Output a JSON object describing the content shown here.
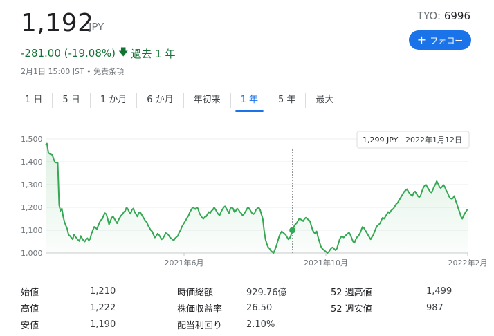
{
  "quote": {
    "price": "1,192",
    "currency": "JPY",
    "exchange": "TYO:",
    "symbol": "6996",
    "follow_label": "フォロー",
    "change": "-281.00 (-19.08%)",
    "period": "過去 1 年",
    "date_note": "2月1日 15:00 JST • 免責条項"
  },
  "colors": {
    "positive": "#137333",
    "accent": "#1a73e8",
    "line": "#34a853"
  },
  "tabs": [
    {
      "label": "1 日",
      "active": false
    },
    {
      "label": "5 日",
      "active": false
    },
    {
      "label": "1 か月",
      "active": false
    },
    {
      "label": "6 か月",
      "active": false
    },
    {
      "label": "年初来",
      "active": false
    },
    {
      "label": "1 年",
      "active": true
    },
    {
      "label": "5 年",
      "active": false
    },
    {
      "label": "最大",
      "active": false
    }
  ],
  "tooltip": {
    "value": "1,299 JPY",
    "date": "2022年1月12日"
  },
  "stats": [
    [
      {
        "label": "始値",
        "value": "1,210"
      },
      {
        "label": "時価総額",
        "value": "929.76億"
      },
      {
        "label": "52 週高値",
        "value": "1,499"
      }
    ],
    [
      {
        "label": "高値",
        "value": "1,222"
      },
      {
        "label": "株価収益率",
        "value": "26.50"
      },
      {
        "label": "52 週安値",
        "value": "987"
      }
    ],
    [
      {
        "label": "安値",
        "value": "1,190"
      },
      {
        "label": "配当利回り",
        "value": "2.10%"
      },
      {
        "label": "",
        "value": ""
      }
    ]
  ],
  "chart_data": {
    "type": "line",
    "ylim": [
      1000,
      1500
    ],
    "yticks": [
      "1,500",
      "1,400",
      "1,300",
      "1,200",
      "1,100",
      "1,000"
    ],
    "xticks": [
      "2021年6月",
      "2021年10月",
      "2022年2月"
    ],
    "grid": true,
    "highlight_index": 183,
    "values": [
      1473,
      1480,
      1440,
      1435,
      1432,
      1430,
      1410,
      1397,
      1396,
      1395,
      1210,
      1185,
      1195,
      1160,
      1135,
      1120,
      1105,
      1080,
      1075,
      1068,
      1060,
      1080,
      1072,
      1065,
      1058,
      1052,
      1075,
      1065,
      1055,
      1050,
      1060,
      1065,
      1055,
      1062,
      1085,
      1100,
      1115,
      1110,
      1105,
      1120,
      1135,
      1145,
      1150,
      1165,
      1175,
      1170,
      1150,
      1125,
      1140,
      1155,
      1160,
      1150,
      1140,
      1130,
      1145,
      1155,
      1165,
      1170,
      1180,
      1185,
      1200,
      1192,
      1180,
      1172,
      1190,
      1195,
      1180,
      1170,
      1160,
      1175,
      1180,
      1170,
      1160,
      1150,
      1140,
      1135,
      1120,
      1110,
      1100,
      1095,
      1080,
      1068,
      1075,
      1085,
      1080,
      1070,
      1060,
      1065,
      1075,
      1088,
      1085,
      1080,
      1070,
      1065,
      1060,
      1055,
      1065,
      1070,
      1075,
      1090,
      1100,
      1115,
      1125,
      1135,
      1145,
      1155,
      1165,
      1180,
      1190,
      1200,
      1197,
      1192,
      1200,
      1195,
      1175,
      1165,
      1155,
      1150,
      1158,
      1160,
      1170,
      1180,
      1175,
      1185,
      1190,
      1200,
      1190,
      1180,
      1170,
      1165,
      1180,
      1190,
      1200,
      1205,
      1195,
      1185,
      1175,
      1195,
      1200,
      1195,
      1180,
      1185,
      1195,
      1190,
      1180,
      1175,
      1165,
      1170,
      1180,
      1190,
      1200,
      1195,
      1185,
      1175,
      1170,
      1175,
      1190,
      1195,
      1200,
      1190,
      1170,
      1150,
      1100,
      1060,
      1040,
      1025,
      1020,
      1010,
      1005,
      1000,
      1015,
      1030,
      1050,
      1070,
      1085,
      1095,
      1090,
      1085,
      1080,
      1070,
      1060,
      1065,
      1080,
      1100,
      1115,
      1125,
      1130,
      1140,
      1150,
      1148,
      1145,
      1140,
      1150,
      1155,
      1150,
      1145,
      1140,
      1120,
      1100,
      1090,
      1085,
      1095,
      1070,
      1050,
      1030,
      1020,
      1015,
      1010,
      1005,
      1000,
      1005,
      1015,
      1022,
      1025,
      1018,
      1012,
      1020,
      1040,
      1060,
      1070,
      1072,
      1068,
      1075,
      1080,
      1085,
      1090,
      1080,
      1065,
      1050,
      1045,
      1060,
      1070,
      1075,
      1085,
      1100,
      1115,
      1110,
      1100,
      1090,
      1080,
      1070,
      1060,
      1070,
      1080,
      1095,
      1110,
      1120,
      1125,
      1130,
      1145,
      1155,
      1150,
      1160,
      1170,
      1180,
      1175,
      1185,
      1190,
      1195,
      1205,
      1215,
      1220,
      1230,
      1240,
      1250,
      1260,
      1270,
      1275,
      1280,
      1270,
      1260,
      1255,
      1250,
      1265,
      1270,
      1260,
      1250,
      1245,
      1250,
      1270,
      1285,
      1295,
      1300,
      1290,
      1280,
      1270,
      1265,
      1275,
      1290,
      1300,
      1315,
      1305,
      1290,
      1285,
      1290,
      1299,
      1290,
      1275,
      1265,
      1250,
      1240,
      1238,
      1240,
      1250,
      1230,
      1215,
      1195,
      1180,
      1160,
      1150,
      1165,
      1175,
      1185,
      1192
    ]
  }
}
